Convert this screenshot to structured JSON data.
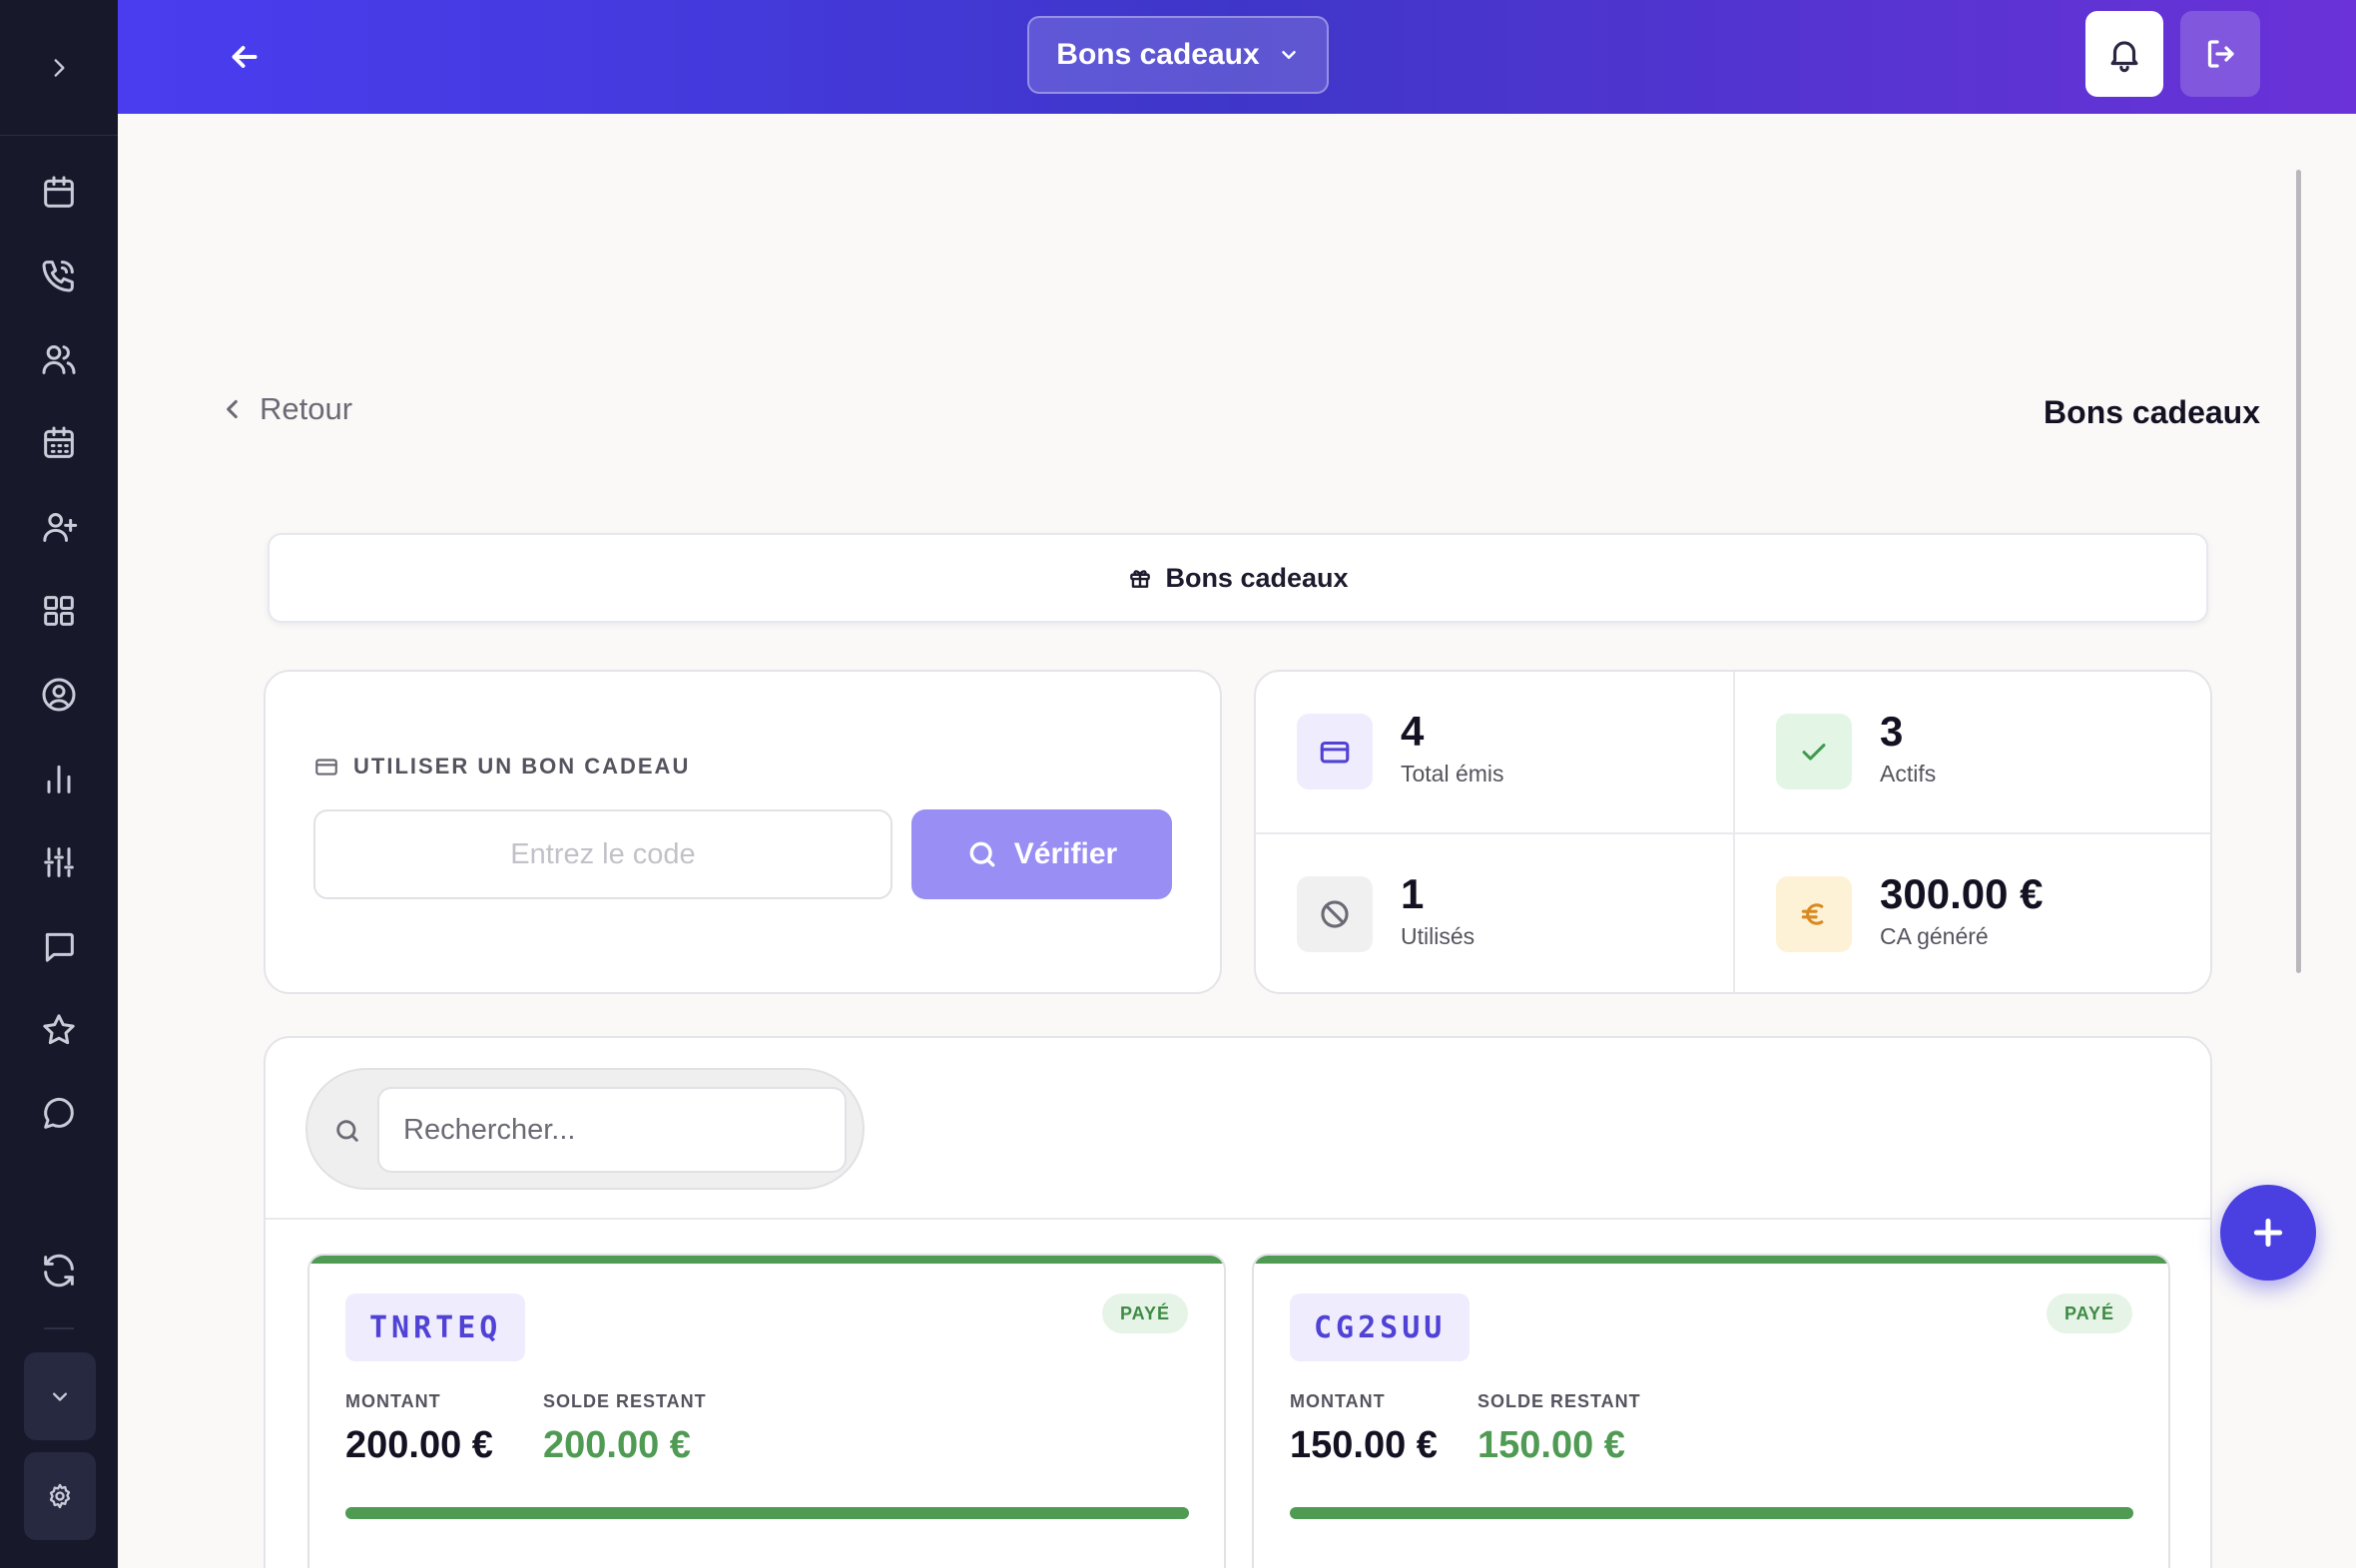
{
  "header": {
    "section_select": "Bons cadeaux"
  },
  "page": {
    "back_label": "Retour",
    "title": "Bons cadeaux",
    "tab_label": "Bons cadeaux"
  },
  "use_voucher": {
    "heading": "UTILISER UN BON CADEAU",
    "code_placeholder": "Entrez le code",
    "verify_label": "Vérifier"
  },
  "stats": [
    {
      "value": "4",
      "label": "Total émis",
      "icon": "card-icon",
      "color": "#5142d6",
      "bg": "#efedfd"
    },
    {
      "value": "3",
      "label": "Actifs",
      "icon": "check-icon",
      "color": "#3f9b4f",
      "bg": "#e3f6e6"
    },
    {
      "value": "1",
      "label": "Utilisés",
      "icon": "ban-icon",
      "color": "#6b6a75",
      "bg": "#f0f0f1"
    },
    {
      "value": "300.00 €",
      "label": "CA généré",
      "icon": "euro-icon",
      "color": "#d98a1f",
      "bg": "#fdf1d6"
    }
  ],
  "search": {
    "placeholder": "Rechercher..."
  },
  "vouchers": [
    {
      "code": "TNRTEQ",
      "status": "PAYÉ",
      "amount_label": "MONTANT",
      "amount": "200.00 €",
      "balance_label": "SOLDE RESTANT",
      "balance": "200.00 €",
      "remaining_fraction": 1.0
    },
    {
      "code": "CG2SUU",
      "status": "PAYÉ",
      "amount_label": "MONTANT",
      "amount": "150.00 €",
      "balance_label": "SOLDE RESTANT",
      "balance": "150.00 €",
      "remaining_fraction": 1.0
    }
  ],
  "colors": {
    "accent": "#4a3fe0",
    "sidebar": "#17192b",
    "success": "#4f9b53",
    "verify_button": "#998ef4"
  }
}
